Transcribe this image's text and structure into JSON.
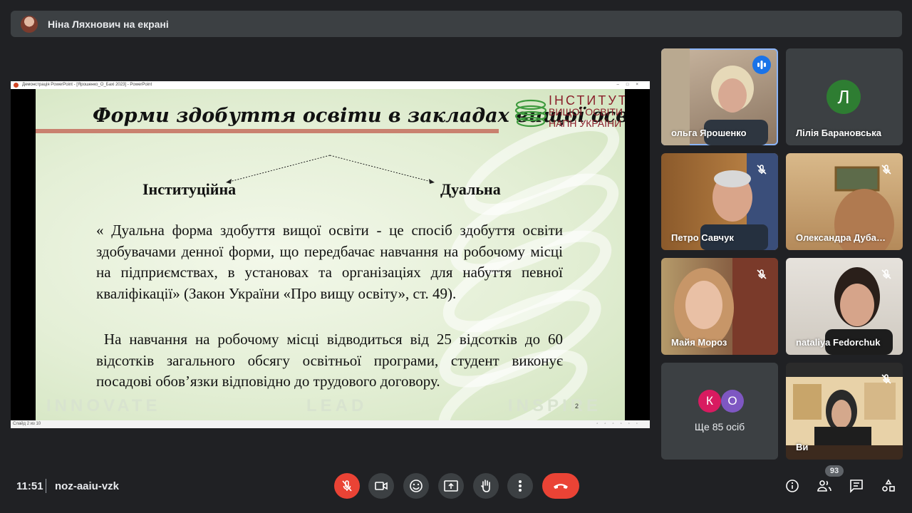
{
  "top_bar": {
    "presenter_label": "Ніна Ляхнович на екрані"
  },
  "ppt_window": {
    "title": "Демонстрація PowerPoint - [Ярошенко_О_Бахі 2023] - PowerPoint",
    "controls": [
      "–",
      "□",
      "×"
    ],
    "status_left": "Слайд 2 из 10"
  },
  "slide": {
    "title": "Форми здобуття освіти в закладах вищої освіти",
    "logo": {
      "line1": "ІНСТИТУТ",
      "line2": "ВИЩОЇ ОСВІТИ",
      "line3": "НАПН УКРАЇНИ"
    },
    "label_left": "Інституційна",
    "label_right": "Дуальна",
    "paragraph1": "« Дуальна форма здобуття вищої освіти - це спосіб здобуття освіти здобувачами денної форми, що передбачає навчання на робочому місці на підприємствах, в установах та організаціях для набуття певної кваліфікації» (Закон України «Про вищу освіту», ст. 49).",
    "paragraph2": " На навчання на робочому місці відводиться від 25 відсотків до 60 відсотків загального обсягу освітньої програми, студент виконує посадові обов’язки відповідно до трудового договору.",
    "footer_words": [
      "INNOVATE",
      "LEAD",
      "INSPIRE"
    ],
    "slide_number": "2"
  },
  "participants": [
    {
      "name": "ольга Ярошенко",
      "speaking": true
    },
    {
      "name": "Лілія Барановська",
      "initial": "Л",
      "avatar_color": "#2e7d32"
    },
    {
      "name": "Петро Савчук",
      "muted": true
    },
    {
      "name": "Олександра Дуба…",
      "muted": true
    },
    {
      "name": "Майя Мороз",
      "muted": true
    },
    {
      "name": "nataliya Fedorchuk",
      "muted": true
    },
    {
      "name": "Ви",
      "muted": true
    }
  ],
  "more_tile": {
    "initials": [
      "К",
      "О"
    ],
    "colors": [
      "#d81b60",
      "#7e57c2"
    ],
    "label": "Ще 85 осіб"
  },
  "bottom_bar": {
    "time": "11:51",
    "meeting_code": "noz-aaiu-vzk",
    "people_count": "93",
    "colors": {
      "red": "#ea4335",
      "button": "#3c4043"
    }
  }
}
